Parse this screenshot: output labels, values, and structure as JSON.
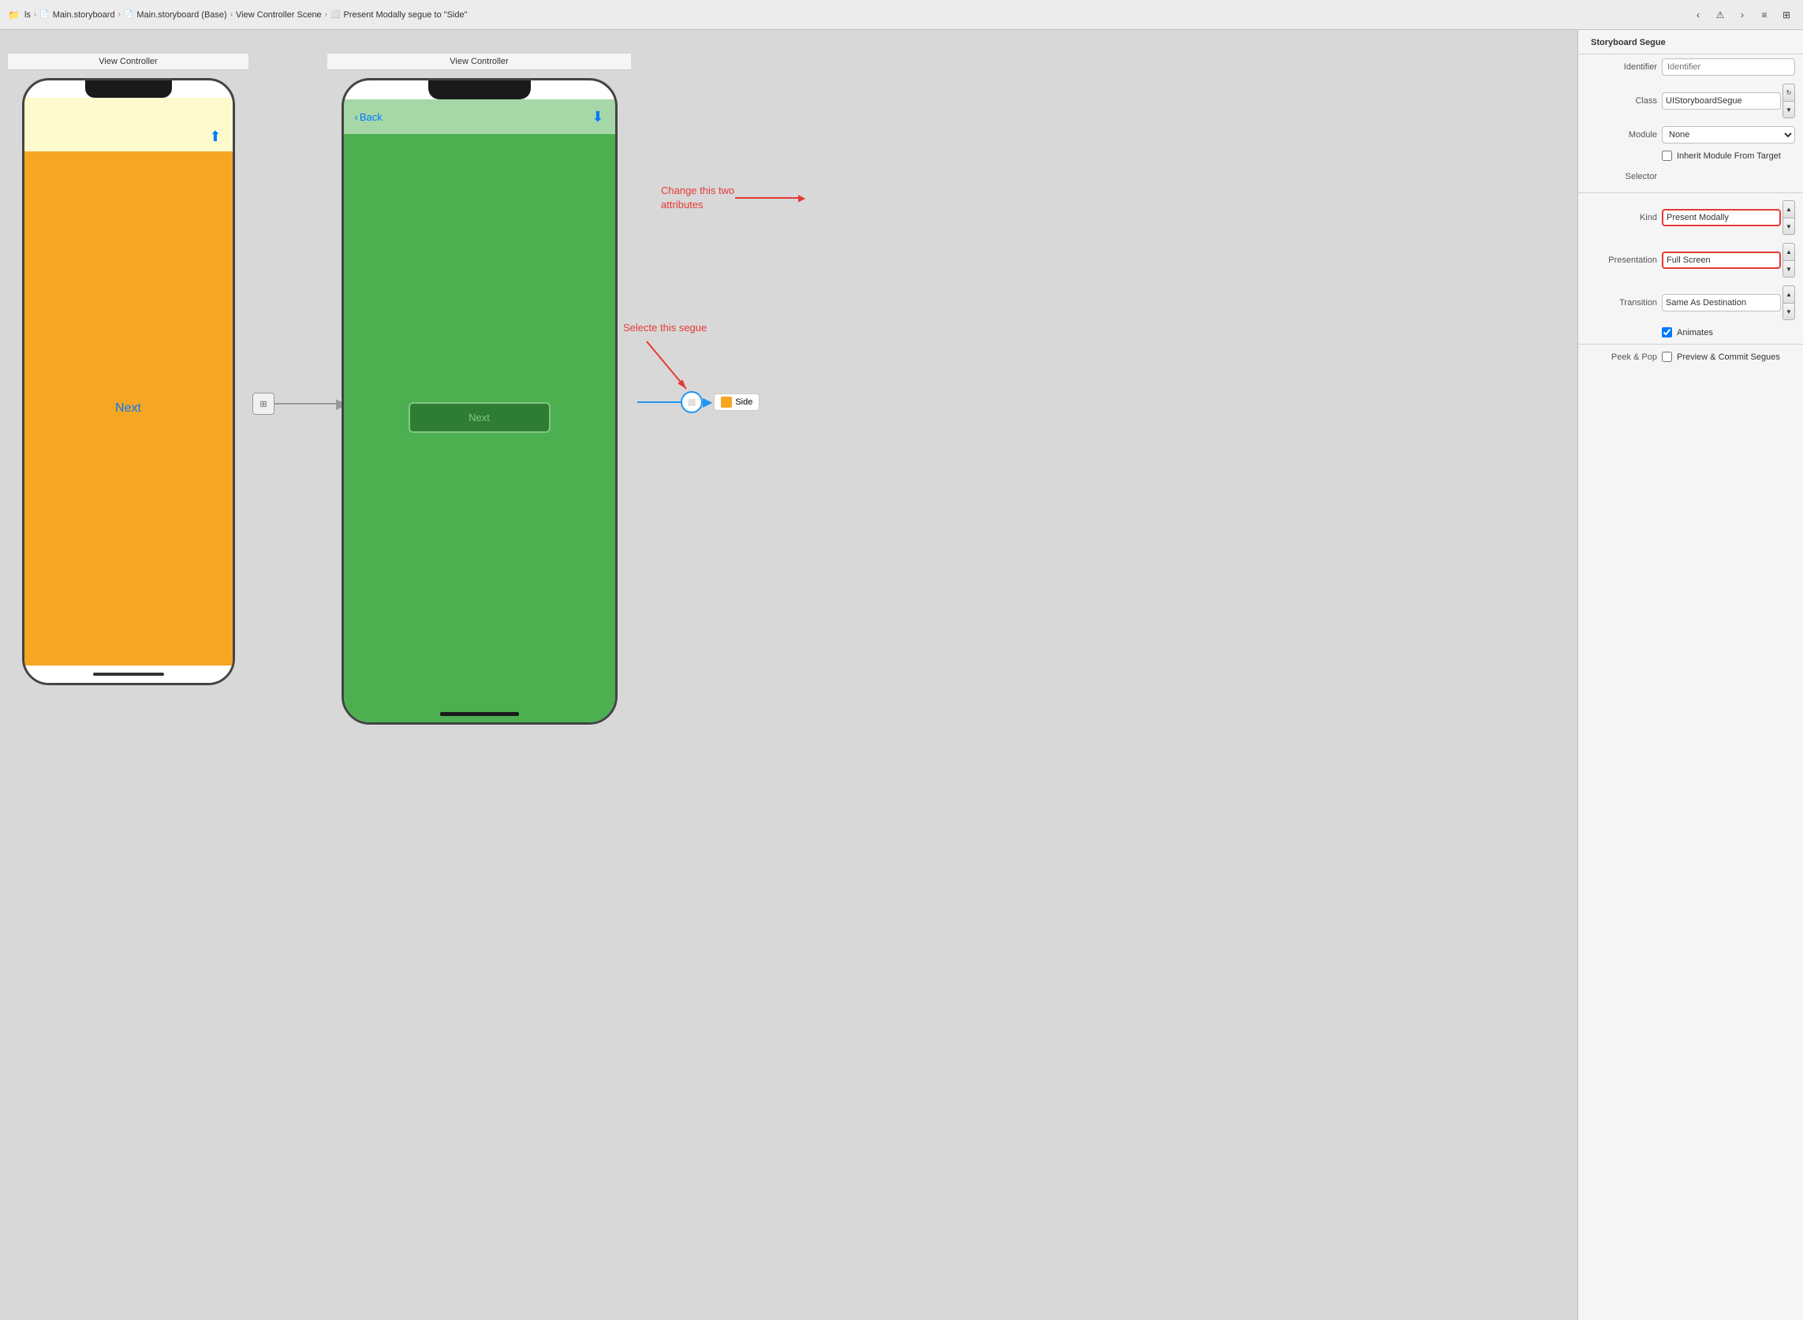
{
  "toolbar": {
    "breadcrumbs": [
      {
        "label": "ls",
        "icon": "folder"
      },
      {
        "label": "Main.storyboard"
      },
      {
        "label": "Main.storyboard (Base)"
      },
      {
        "label": "View Controller Scene"
      },
      {
        "label": "Present Modally segue to \"Side\""
      }
    ],
    "nav_back": "‹",
    "nav_warning": "⚠",
    "nav_forward": "›"
  },
  "canvas": {
    "vc_left_title": "View Controller",
    "vc_right_title": "View Controller",
    "phone_left_next": "Next",
    "phone_right_next": "Next",
    "phone_right_back": "Back",
    "side_chip_label": "Side",
    "annotation_change": "Change this two\nattributes",
    "annotation_select": "Selecte this segue"
  },
  "inspector": {
    "title": "Storyboard Segue",
    "identifier_label": "Identifier",
    "identifier_placeholder": "Identifier",
    "class_label": "Class",
    "class_value": "UIStoryboardSegue",
    "module_label": "Module",
    "module_value": "None",
    "inherit_label": "Inherit Module From Target",
    "selector_label": "Selector",
    "kind_label": "Kind",
    "kind_value": "Present Modally",
    "presentation_label": "Presentation",
    "presentation_value": "Full Screen",
    "transition_label": "Transition",
    "transition_value": "Same As Destination",
    "animates_label": "Animates",
    "peek_label": "Peek & Pop",
    "peek_checkbox_label": "Preview & Commit Segues"
  }
}
